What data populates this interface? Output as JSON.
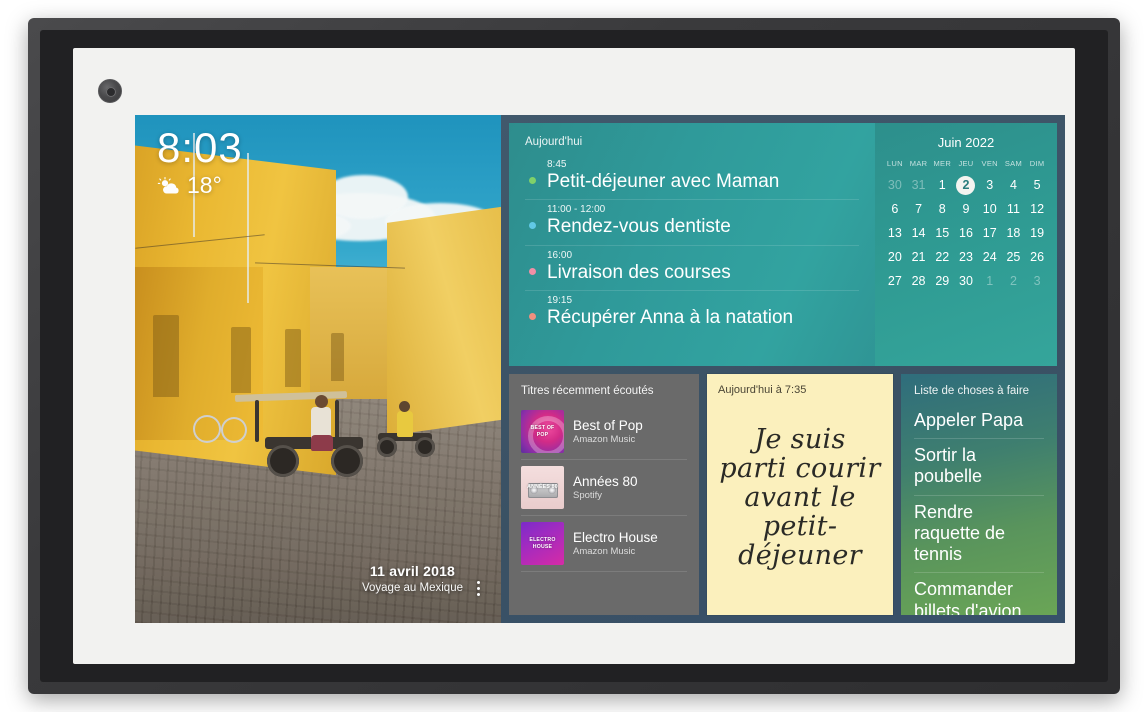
{
  "device": {
    "name": "smart-display-photo-frame",
    "camera_icon": "camera-icon"
  },
  "screen": {
    "photo": {
      "clock": {
        "time": "8:03",
        "temperature": "18°",
        "weather_icon": "sun-behind-cloud-icon"
      },
      "caption": {
        "date": "11 avril 2018",
        "subtitle": "Voyage au Mexique"
      },
      "menu_icon": "more-vertical-icon"
    },
    "agenda": {
      "header": "Aujourd'hui",
      "items": [
        {
          "time": "8:45",
          "title": "Petit-déjeuner avec Maman",
          "dot_color": "#7fd16a"
        },
        {
          "time": "11:00 - 12:00",
          "title": "Rendez-vous dentiste",
          "dot_color": "#61c9e6"
        },
        {
          "time": "16:00",
          "title": "Livraison des courses",
          "dot_color": "#f08fa6"
        },
        {
          "time": "19:15",
          "title": "Récupérer Anna à la natation",
          "dot_color": "#f0907f"
        }
      ]
    },
    "calendar": {
      "title": "Juin 2022",
      "weekdays": [
        "LUN",
        "MAR",
        "MER",
        "JEU",
        "VEN",
        "SAM",
        "DIM"
      ],
      "today": "2",
      "weeks": [
        [
          {
            "d": "30",
            "o": true
          },
          {
            "d": "31",
            "o": true
          },
          {
            "d": "1"
          },
          {
            "d": "2",
            "t": true
          },
          {
            "d": "3"
          },
          {
            "d": "4"
          },
          {
            "d": "5"
          }
        ],
        [
          {
            "d": "6"
          },
          {
            "d": "7"
          },
          {
            "d": "8"
          },
          {
            "d": "9"
          },
          {
            "d": "10"
          },
          {
            "d": "11"
          },
          {
            "d": "12"
          }
        ],
        [
          {
            "d": "13"
          },
          {
            "d": "14"
          },
          {
            "d": "15"
          },
          {
            "d": "16"
          },
          {
            "d": "17"
          },
          {
            "d": "18"
          },
          {
            "d": "19"
          }
        ],
        [
          {
            "d": "20"
          },
          {
            "d": "21"
          },
          {
            "d": "22"
          },
          {
            "d": "23"
          },
          {
            "d": "24"
          },
          {
            "d": "25"
          },
          {
            "d": "26"
          }
        ],
        [
          {
            "d": "27"
          },
          {
            "d": "28"
          },
          {
            "d": "29"
          },
          {
            "d": "30"
          },
          {
            "d": "1",
            "o": true
          },
          {
            "d": "2",
            "o": true
          },
          {
            "d": "3",
            "o": true
          }
        ]
      ]
    },
    "music": {
      "header": "Titres récemment écoutés",
      "tracks": [
        {
          "title": "Best of Pop",
          "source": "Amazon Music",
          "art": "art-pop",
          "art_text": "BEST OF\nPOP"
        },
        {
          "title": "Années 80",
          "source": "Spotify",
          "art": "art-80",
          "art_text": "ANNÉES 80"
        },
        {
          "title": "Electro House",
          "source": "Amazon Music",
          "art": "art-electro",
          "art_text": "ELECTRO\nHOUSE"
        }
      ]
    },
    "note": {
      "header": "Aujourd'hui à 7:35",
      "body": "Je suis parti courir avant le petit-déjeuner"
    },
    "todo": {
      "header": "Liste de choses à faire",
      "items": [
        "Appeler Papa",
        "Sortir la poubelle",
        "Rendre raquette de tennis",
        "Commander billets d'avion"
      ]
    }
  }
}
